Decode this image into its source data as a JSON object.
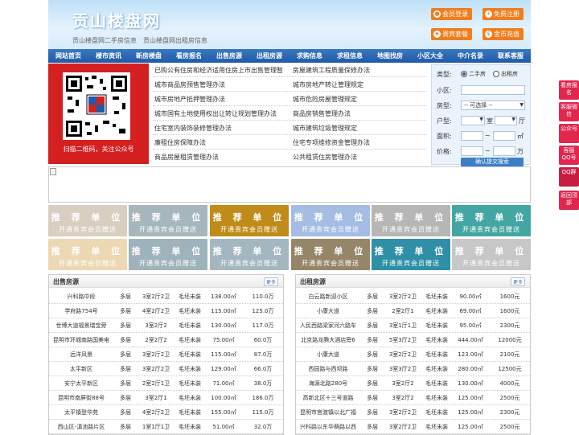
{
  "header": {
    "title": "贡山楼盘网",
    "sub1": "贡山楼盘网二手房信息",
    "sub2": "贡山楼盘网出租房信息",
    "login": "会员登录",
    "register": "免费注册",
    "vip": "贵宾套餐",
    "recharge": "金币充值"
  },
  "nav": [
    "网站首页",
    "楼市资讯",
    "新房楼盘",
    "看房报名",
    "出售房源",
    "出租房源",
    "求购信息",
    "求租信息",
    "地图找房",
    "小区大全",
    "中介名录",
    "联系客服"
  ],
  "qr": {
    "caption": "扫描二维码，关注公众号"
  },
  "links": {
    "left": [
      "已购公有住房和经济适用住房上市出售管理暂",
      "城市商品房预售管理办法",
      "城市房地产抵押管理办法",
      "城市国有土地使用权出让转让规划管理办法",
      "住宅室内装饰装修管理办法",
      "廉租住房保障办法",
      "商品房屋租赁管理办法"
    ],
    "right": [
      "房屋建筑工程质量保修办法",
      "城市房地产转让管理规定",
      "城市危险房屋管理规定",
      "商品房销售管理办法",
      "城市建筑垃圾管理规定",
      "住宅专项维修资金管理办法",
      "公共租赁住房管理办法"
    ]
  },
  "search": {
    "type_label": "类型:",
    "type_opt1": "二手房",
    "type_opt2": "出租房",
    "community_label": "小区:",
    "houseType_label": "房型:",
    "houseType_value": "-- 可选择 --",
    "layout_label": "户型:",
    "shi": "室",
    "ting": "厅",
    "area_label": "面积:",
    "sqm": "㎡",
    "price_label": "价格:",
    "wan": "万",
    "submit": "确认提交搜索"
  },
  "tiles": {
    "title": "推 荐 单 位",
    "sub": "开通贵宾会员赠送"
  },
  "sale": {
    "title": "出售房源",
    "more": "更多",
    "rows": [
      [
        "兴科路中段",
        "多层",
        "3室2厅2卫",
        "毛坯未装",
        "138.00㎡",
        "110.0万"
      ],
      [
        "学府路754号",
        "多层",
        "4室2厅2卫",
        "毛坯未装",
        "115.00㎡",
        "125.0万"
      ],
      [
        "世博大道福景瑞宝旁",
        "多层",
        "3室2厅2",
        "毛坯未装",
        "130.00㎡",
        "117.0万"
      ],
      [
        "昆明市环城南路国美电",
        "多层",
        "2室2厅2",
        "毛坯未装",
        "75.00㎡",
        "60.0万"
      ],
      [
        "远洋风景",
        "多层",
        "3室2厅2卫",
        "毛坯未装",
        "115.00㎡",
        "87.0万"
      ],
      [
        "太平新区",
        "多层",
        "3室2厅2卫",
        "毛坯未装",
        "129.00㎡",
        "66.0万"
      ],
      [
        "安宁太平新区",
        "多层",
        "2室2厅1卫",
        "毛坯未装",
        "71.00㎡",
        "38.0万"
      ],
      [
        "昆明市南屏街88号",
        "多层",
        "3室2厅1",
        "毛坯未装",
        "100.00㎡",
        "186.0万"
      ],
      [
        "太平镇登华苑",
        "多层",
        "4室2厅2卫",
        "毛坯未装",
        "155.00㎡",
        "115.0万"
      ],
      [
        "西山区-滇池路片区",
        "多层",
        "1室1厅1卫",
        "毛坯未装",
        "51.00㎡",
        "32.0万"
      ]
    ]
  },
  "rent": {
    "title": "出租房源",
    "more": "更多",
    "rows": [
      [
        "白云路新迎小区",
        "多层",
        "3室2厅2卫",
        "毛坯未装",
        "90.00㎡",
        "1600元"
      ],
      [
        "小康大道",
        "多层",
        "2室2厅1",
        "毛坯未装",
        "69.00㎡",
        "1600元"
      ],
      [
        "人民西路梁家河六路车",
        "多层",
        "3室1厅1卫",
        "毛坯未装",
        "95.00㎡",
        "2300元"
      ],
      [
        "北京路龙腾大酒店旁6",
        "多层",
        "5室3厅2卫",
        "毛坯未装",
        "444.00㎡",
        "12000元"
      ],
      [
        "小康大道",
        "多层",
        "3室2厅2卫",
        "毛坯未装",
        "123.00㎡",
        "2100元"
      ],
      [
        "西园路与西坝路",
        "多层",
        "3室3厅2卫",
        "毛坯未装",
        "280.00㎡",
        "12500元"
      ],
      [
        "海源北路280号",
        "多层",
        "3室2厅2",
        "毛坯未装",
        "130.00㎡",
        "4000元"
      ],
      [
        "高新北区十三号道路",
        "多层",
        "3室2厅2",
        "毛坯未装",
        "125.00㎡",
        "2500元"
      ],
      [
        "昆明市官渡镇以北广福",
        "多层",
        "3室2厅2卫",
        "毛坯未装",
        "125.00㎡",
        "2300元"
      ],
      [
        "兴科路以东华萌路以西",
        "多层",
        "3室2厅2卫",
        "毛坯未装",
        "125.00㎡",
        "2500元"
      ]
    ]
  },
  "side": [
    "看房报名",
    "客服微信",
    "公众号",
    "客服QQ号",
    "QQ群",
    "返回顶部"
  ],
  "colors": {
    "nav": "#1f5aa8",
    "orange": "#f07e1f",
    "red": "#d42020",
    "side": "#e2264d"
  }
}
